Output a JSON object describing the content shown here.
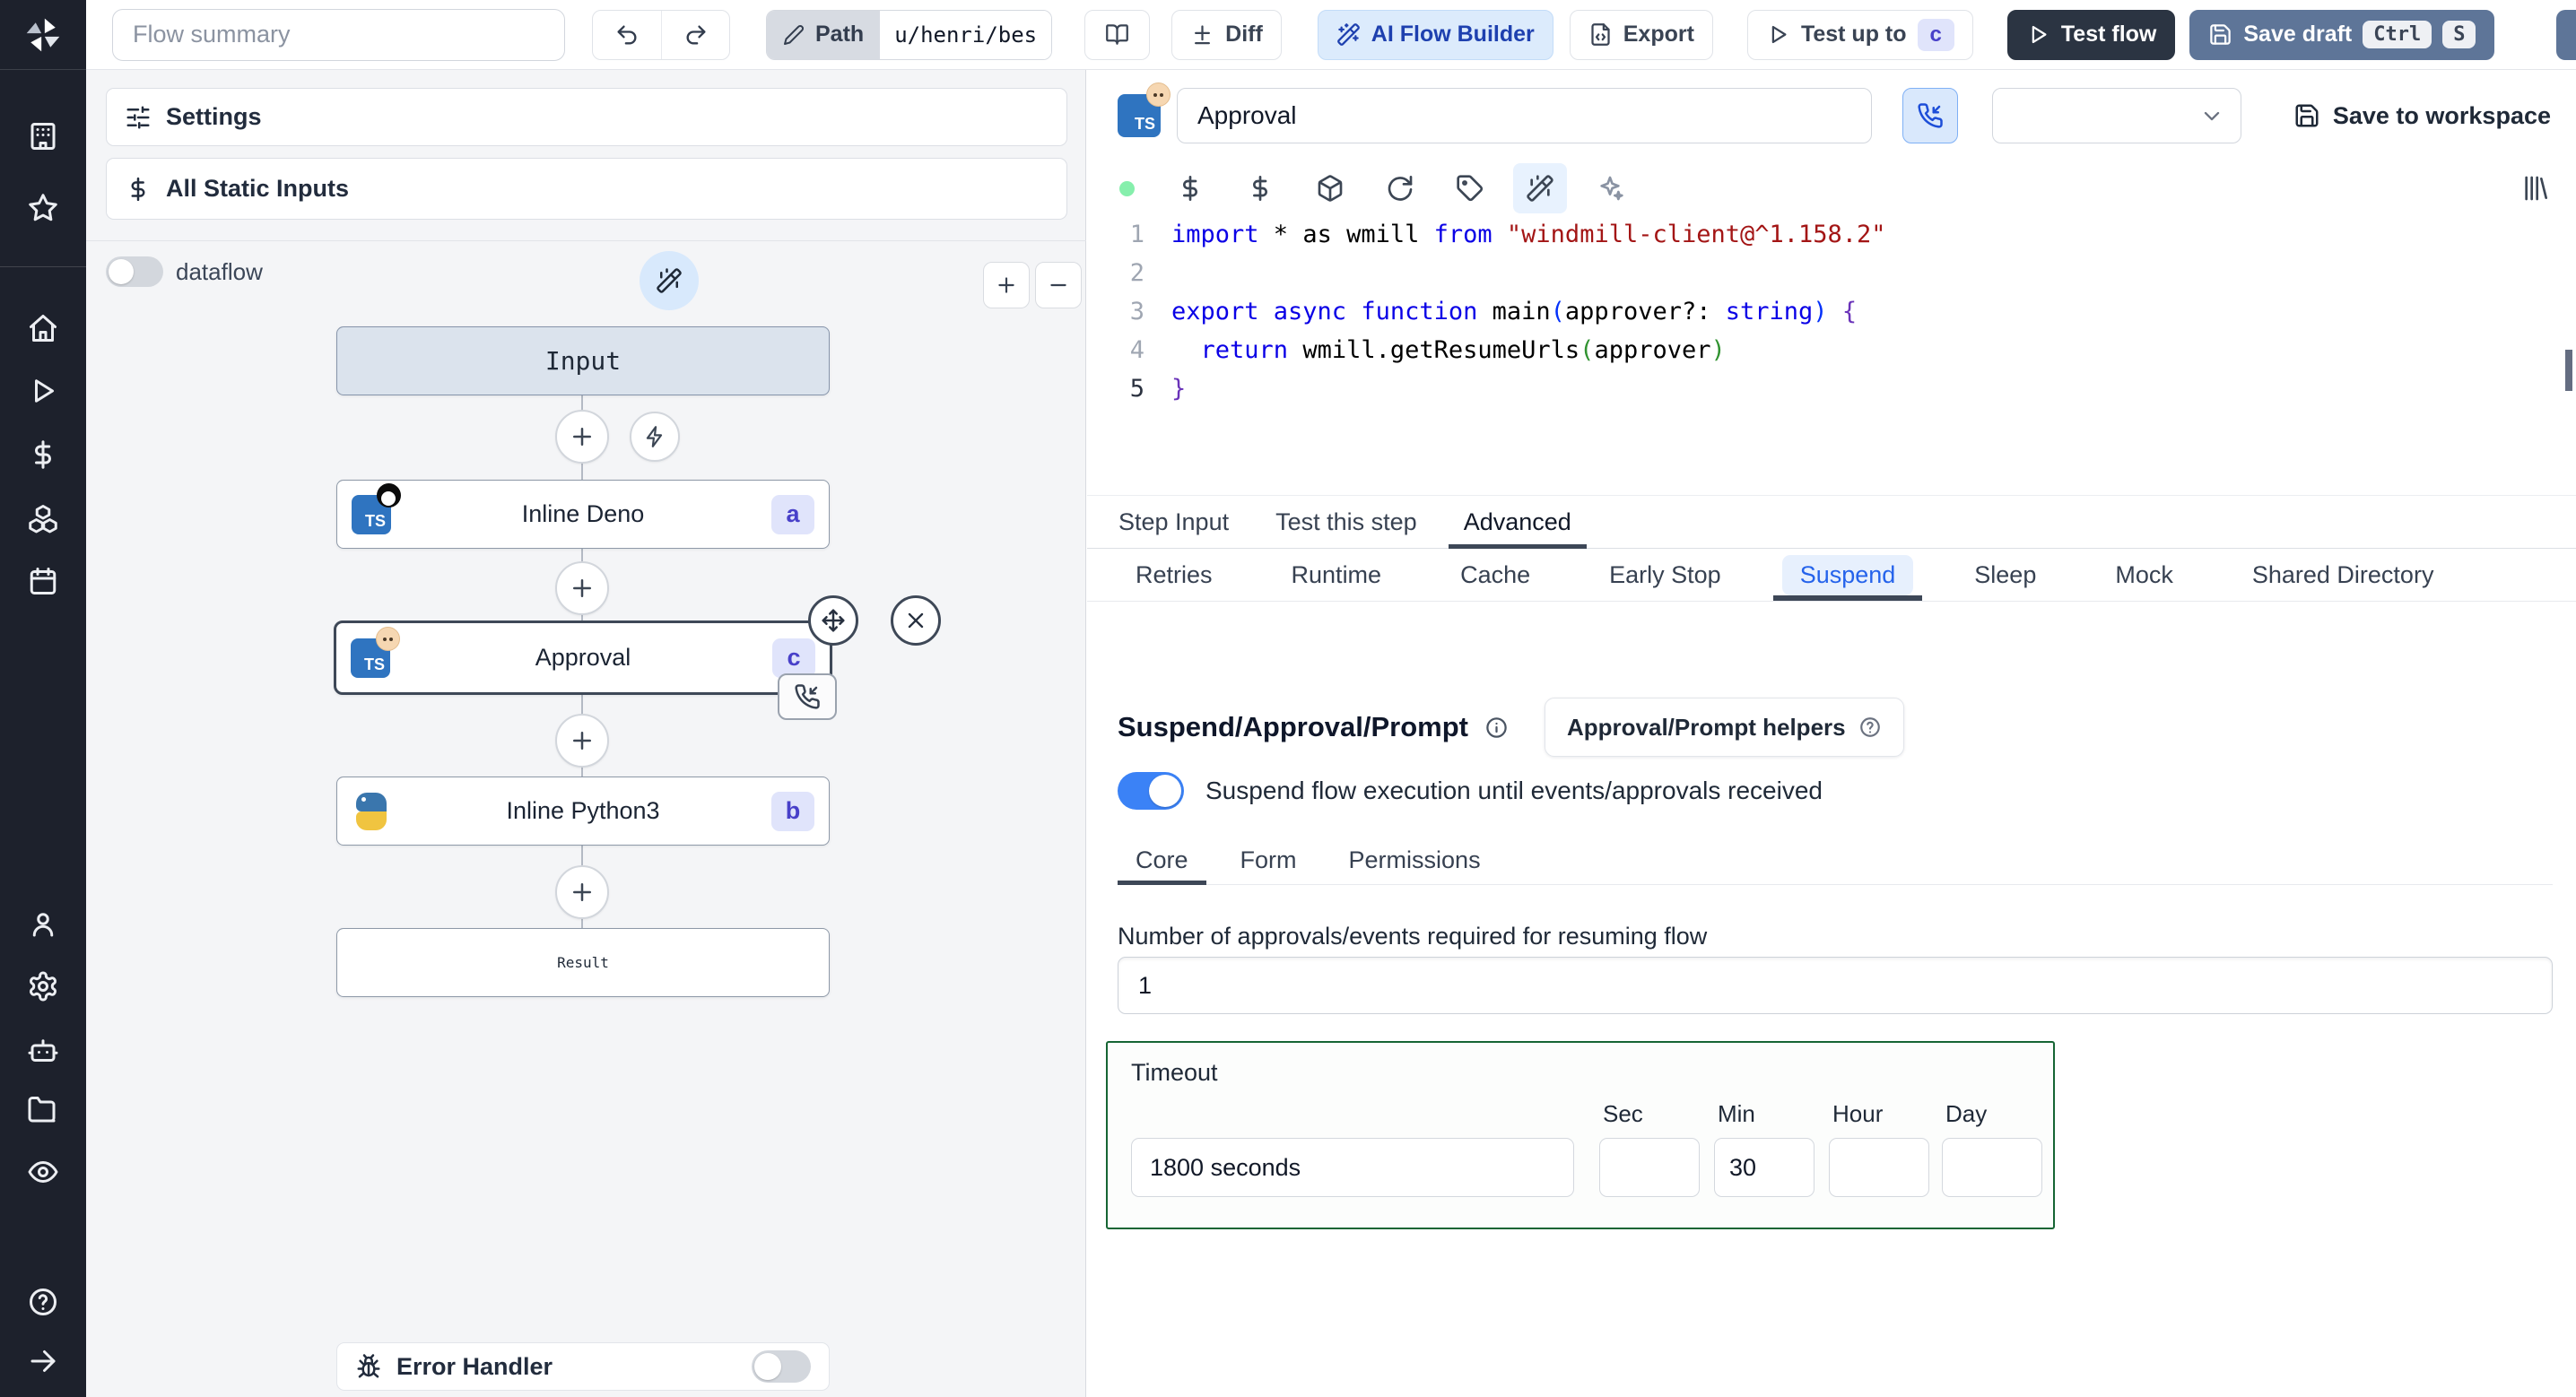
{
  "colors": {
    "accent_blue": "#3b82f6",
    "badge_bg": "#e0e4fb",
    "badge_text": "#4840c9",
    "timeout_border": "#166534",
    "save_draft_bg": "#5e7598",
    "test_flow_bg": "#2b3442",
    "status_dot_green": "#86efac",
    "sidebar_bg": "#1d212c",
    "ts_icon_bg": "#2f74c0"
  },
  "sidebar": {
    "icons_top": [
      "windmill-logo",
      "building",
      "star"
    ],
    "icons_middle": [
      "home",
      "play",
      "dollar",
      "boxes",
      "calendar"
    ],
    "icons_bottom": [
      "user",
      "settings",
      "bot",
      "folder",
      "eye"
    ],
    "icons_footer": [
      "help",
      "arrow-right"
    ]
  },
  "topbar": {
    "flow_summary_placeholder": "Flow summary",
    "path_label": "Path",
    "path_value": "u/henri/bes",
    "diff_label": "Diff",
    "ai_flow_builder_label": "AI Flow Builder",
    "export_label": "Export",
    "test_up_to_label": "Test up to",
    "test_up_to_badge": "c",
    "test_flow_label": "Test flow",
    "save_draft_label": "Save draft",
    "save_draft_key_1": "Ctrl",
    "save_draft_key_2": "S"
  },
  "left_panel": {
    "settings_label": "Settings",
    "static_inputs_label": "All Static Inputs",
    "dataflow_label": "dataflow",
    "error_handler_label": "Error Handler",
    "lang_badge": "TS",
    "nodes": {
      "input_label": "Input",
      "deno_title": "Inline Deno",
      "deno_badge": "a",
      "approval_title": "Approval",
      "approval_badge": "c",
      "python_title": "Inline Python3",
      "python_badge": "b",
      "result_label": "Result"
    }
  },
  "step_editor": {
    "name_value": "Approval",
    "save_to_workspace_label": "Save to workspace",
    "lang_badge": "TS",
    "dropdown_value": "",
    "line_numbers": [
      "1",
      "2",
      "3",
      "4",
      "5"
    ],
    "code": {
      "l1": {
        "k1": "import",
        "t1": " * as wmill ",
        "k2": "from",
        "s1": " \"windmill-client@^1.158.2\""
      },
      "l3": {
        "k1": "export async function",
        "t1": " main",
        "p1": "(",
        "t2": "approver?: ",
        "k2": "string",
        "p2": ")",
        "t3": " ",
        "b1": "{"
      },
      "l4": {
        "t1": "  ",
        "k1": "return",
        "t2": " wmill.getResumeUrls",
        "p1": "(",
        "t3": "approver",
        "p2": ")"
      },
      "l5": {
        "b1": "}"
      }
    },
    "tabs": [
      "Step Input",
      "Test this step",
      "Advanced"
    ],
    "subtabs": [
      "Retries",
      "Runtime",
      "Cache",
      "Early Stop",
      "Suspend",
      "Sleep",
      "Mock",
      "Shared Directory"
    ]
  },
  "suspend": {
    "title": "Suspend/Approval/Prompt",
    "helpers_button_label": "Approval/Prompt helpers",
    "toggle_label": "Suspend flow execution until events/approvals received",
    "tabs": [
      "Core",
      "Form",
      "Permissions"
    ],
    "approvals_label": "Number of approvals/events required for resuming flow",
    "approvals_value": "1",
    "timeout": {
      "label": "Timeout",
      "value": "1800 seconds",
      "units": [
        "Sec",
        "Min",
        "Hour",
        "Day"
      ],
      "sec_value": "",
      "min_value": "30",
      "hour_value": "",
      "day_value": ""
    }
  }
}
